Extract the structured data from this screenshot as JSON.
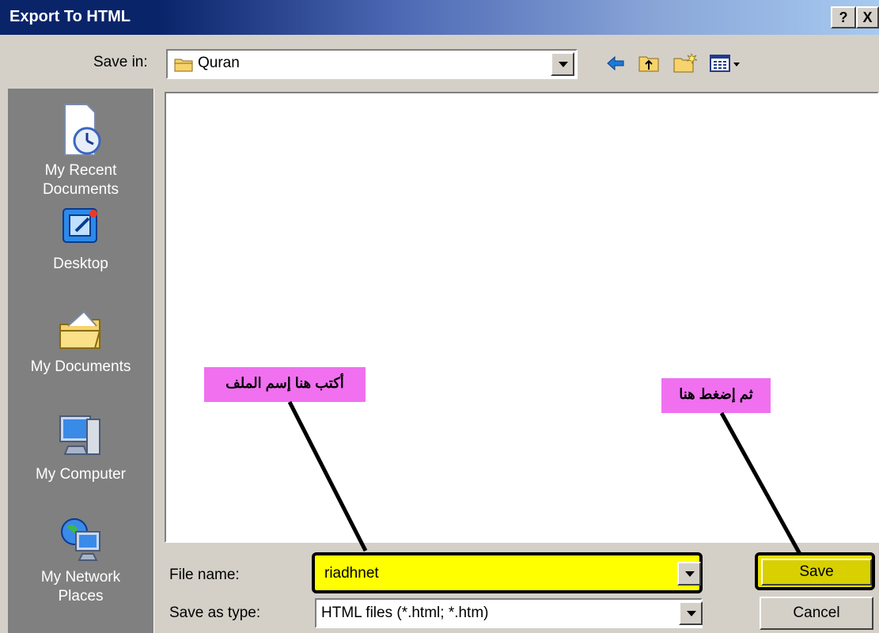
{
  "window": {
    "title": "Export To HTML",
    "help_label": "?",
    "close_label": "X"
  },
  "save_in": {
    "label": "Save in:",
    "value": "Quran"
  },
  "places": [
    {
      "label": "My Recent Documents",
      "line1": "My Recent",
      "line2": "Documents",
      "icon": "recent-documents-icon"
    },
    {
      "label": "Desktop",
      "line1": "Desktop",
      "line2": "",
      "icon": "desktop-icon"
    },
    {
      "label": "My Documents",
      "line1": "My Documents",
      "line2": "",
      "icon": "my-documents-icon"
    },
    {
      "label": "My Computer",
      "line1": "My Computer",
      "line2": "",
      "icon": "my-computer-icon"
    },
    {
      "label": "My Network Places",
      "line1": "My Network",
      "line2": "Places",
      "icon": "network-places-icon"
    }
  ],
  "file_name": {
    "label": "File name:",
    "value": "riadhnet"
  },
  "save_as_type": {
    "label": "Save as type:",
    "value": "HTML files (*.html; *.htm)"
  },
  "buttons": {
    "save": "Save",
    "cancel": "Cancel"
  },
  "annotations": {
    "filename_hint": "أكتب هنا إسم الملف",
    "save_hint": "ثم إضغط هنا"
  },
  "colors": {
    "highlight": "#ffff00",
    "callout": "#f070f0",
    "titlebar": "#0a246a"
  }
}
